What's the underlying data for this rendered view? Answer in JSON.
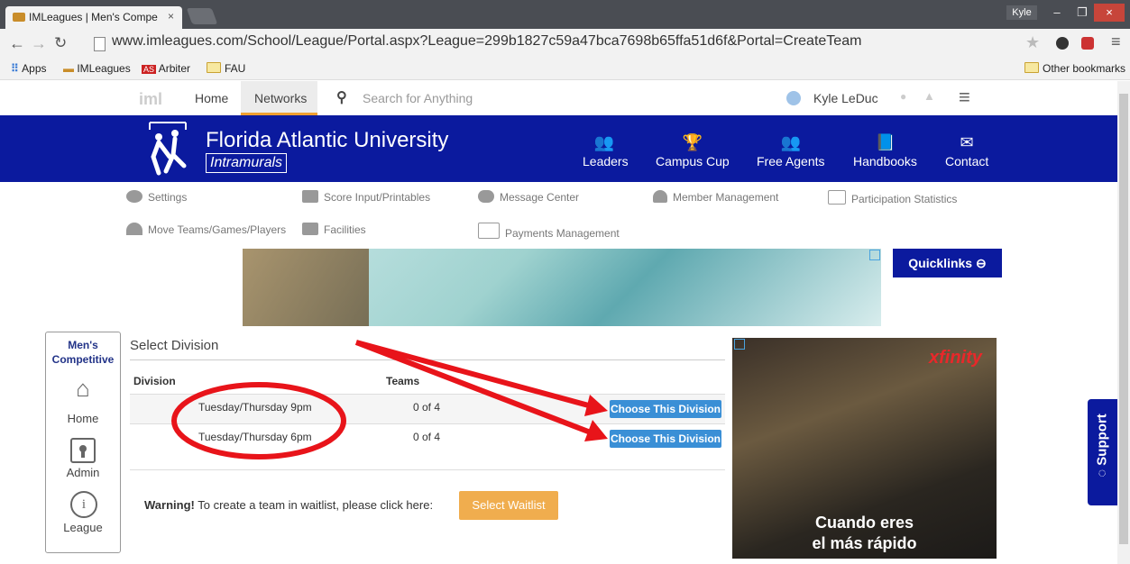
{
  "browser": {
    "tab_title": "IMLeagues | Men's Compe",
    "tab_close": "×",
    "user": "Kyle",
    "url": "www.imleagues.com/School/League/Portal.aspx?League=299b1827c59a47bca7698b65ffa51d6f&Portal=CreateTeam",
    "bookmarks": [
      "Apps",
      "IMLeagues",
      "Arbiter",
      "FAU"
    ],
    "other_bookmarks": "Other bookmarks"
  },
  "nav": {
    "home": "Home",
    "networks": "Networks",
    "search_placeholder": "Search for Anything",
    "user_name": "Kyle LeDuc"
  },
  "banner": {
    "university": "Florida Atlantic University",
    "subtitle": "Intramurals",
    "links": [
      "Leaders",
      "Campus Cup",
      "Free Agents",
      "Handbooks",
      "Contact"
    ]
  },
  "tools": {
    "row1": [
      "Settings",
      "Score Input/Printables",
      "Message Center",
      "Member Management",
      "Participation Statistics"
    ],
    "row2": [
      "Move Teams/Games/Players",
      "Facilities",
      "Payments Management"
    ]
  },
  "quicklinks": "Quicklinks",
  "sidebar": {
    "title_line1": "Men's",
    "title_line2": "Competitive",
    "items": [
      "Home",
      "Admin",
      "League"
    ]
  },
  "division": {
    "heading": "Select Division",
    "col_division": "Division",
    "col_teams": "Teams",
    "rows": [
      {
        "name": "Tuesday/Thursday 9pm",
        "teams": "0 of 4",
        "action": "Choose This Division"
      },
      {
        "name": "Tuesday/Thursday 6pm",
        "teams": "0 of 4",
        "action": "Choose This Division"
      }
    ]
  },
  "warning": {
    "label": "Warning!",
    "text": " To create a team in waitlist, please click here:",
    "button": "Select Waitlist"
  },
  "ad": {
    "brand": "xfinity",
    "line1": "Cuando eres",
    "line2": "el más rápido"
  },
  "support": "Support",
  "colors": {
    "banner": "#0b1a9e",
    "button_blue": "#3a8fd6",
    "waitlist": "#f0ad4e",
    "annotation_red": "#e8141a"
  }
}
